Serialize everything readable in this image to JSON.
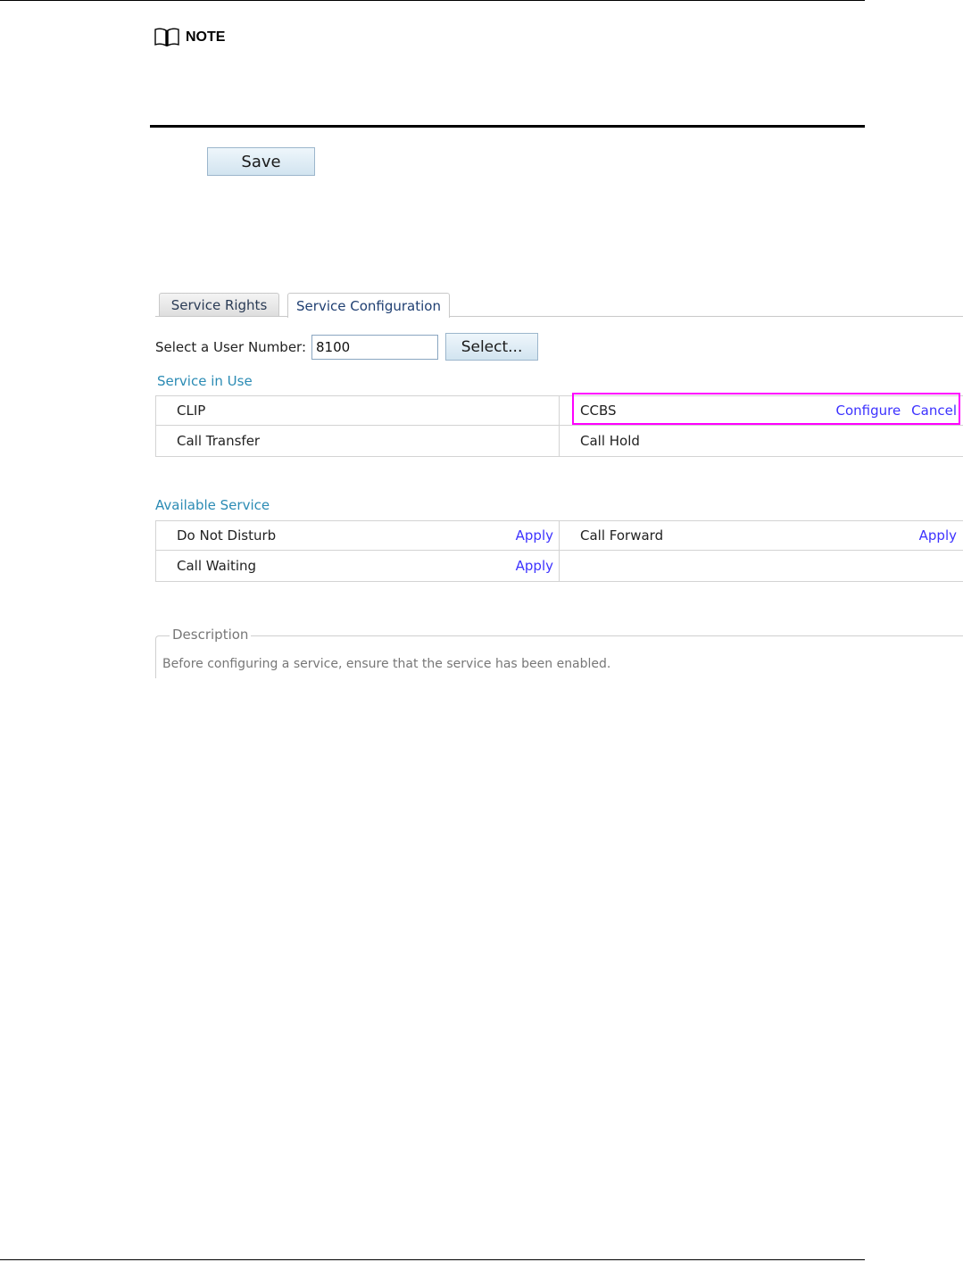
{
  "note": {
    "label": "NOTE"
  },
  "save": {
    "label": "Save"
  },
  "tabs": [
    {
      "label": "Service Rights"
    },
    {
      "label": "Service Configuration"
    }
  ],
  "user_select": {
    "label": "Select a User Number:",
    "value": "8100",
    "button": "Select..."
  },
  "service_in_use": {
    "title": "Service in Use",
    "rows": [
      {
        "left": "CLIP",
        "right": "CCBS",
        "configure": "Configure",
        "cancel": "Cancel"
      },
      {
        "left": "Call Transfer",
        "right": "Call Hold"
      }
    ]
  },
  "available_service": {
    "title": "Available Service",
    "rows": [
      {
        "left": "Do Not Disturb",
        "left_action": "Apply",
        "right": "Call Forward",
        "right_action": "Apply"
      },
      {
        "left": "Call Waiting",
        "left_action": "Apply"
      }
    ]
  },
  "description": {
    "legend": "Description",
    "text": "Before configuring a service, ensure that the service has been enabled."
  },
  "colors": {
    "link": "#3d32ff",
    "section_title": "#2b8bb4",
    "highlight": "#ff00ff"
  }
}
